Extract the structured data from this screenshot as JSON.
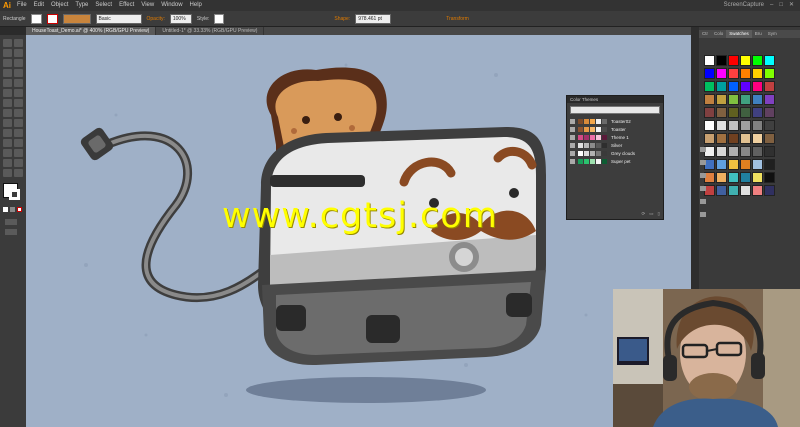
{
  "app": {
    "logo": "Ai",
    "menu": [
      "File",
      "Edit",
      "Object",
      "Type",
      "Select",
      "Effect",
      "View",
      "Window",
      "Help"
    ],
    "workspace": "ScreenCapture"
  },
  "control_bar": {
    "tool_name": "Rectangle",
    "stroke_style": "Basic",
    "opacity_label": "Opacity:",
    "opacity_value": "100%",
    "style_label": "Style:",
    "shape_label": "Shape:",
    "transform_label": "Transform",
    "x_value": "978.461 pt"
  },
  "doc_tabs": [
    {
      "label": "HouseToast_Demo.ai* @ 400% (RGB/GPU Preview)",
      "active": true
    },
    {
      "label": "Untitled-1* @ 33.33% (RGB/GPU Preview)",
      "active": false
    }
  ],
  "right_panel": {
    "tabs": [
      "Ctr",
      "Colo",
      "Swatches",
      "Bru",
      "Sym"
    ],
    "active_tab": "Swatches"
  },
  "color_themes": {
    "title": "Color Themes",
    "themes": [
      {
        "name": "Toaster02",
        "colors": [
          "#7b4a2a",
          "#d88a3a",
          "#f2a64a",
          "#eeeeee",
          "#6a6a6a"
        ]
      },
      {
        "name": "Toaster",
        "colors": [
          "#8a5230",
          "#e69a48",
          "#f7b86a",
          "#f4f4f4",
          "#4c4c4c"
        ]
      },
      {
        "name": "Theme 1",
        "colors": [
          "#d34a86",
          "#a1306a",
          "#f06fa8",
          "#f9c2da",
          "#5a1a3a"
        ]
      },
      {
        "name": "Silver",
        "colors": [
          "#e0e0e0",
          "#b8b8b8",
          "#8c8c8c",
          "#5a5a5a",
          "#2e2e2e"
        ]
      },
      {
        "name": "Grey clouds",
        "colors": [
          "#ffffff",
          "#dcdcdc",
          "#b2b2b2",
          "#7a7a7a",
          "#3a3a3a"
        ]
      },
      {
        "name": "Super pet",
        "colors": [
          "#1a9e5a",
          "#2bc36f",
          "#9fe2b0",
          "#f5f5f5",
          "#0d5c33"
        ]
      }
    ]
  },
  "watermark": "www.cgtsj.com",
  "colors": {
    "canvas_bg": "#9fb0c7",
    "watermark": "#ffff00",
    "ui_dark": "#3b3b3b"
  }
}
